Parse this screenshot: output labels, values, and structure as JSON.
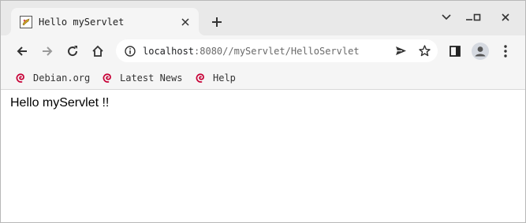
{
  "tab": {
    "title": "Hello myServlet",
    "close": "✕"
  },
  "window_controls": {
    "tab_search": "⌄",
    "minimize": "–",
    "maximize": "□",
    "close": "✕"
  },
  "address_bar": {
    "host": "localhost",
    "rest": ":8080//myServlet/HelloServlet"
  },
  "bookmarks": [
    {
      "label": "Debian.org"
    },
    {
      "label": "Latest News"
    },
    {
      "label": "Help"
    }
  ],
  "page": {
    "text": "Hello myServlet !!"
  },
  "colors": {
    "debian_red": "#c70036",
    "chrome_bg": "#e9e9e9",
    "toolbar_bg": "#f5f5f5"
  }
}
